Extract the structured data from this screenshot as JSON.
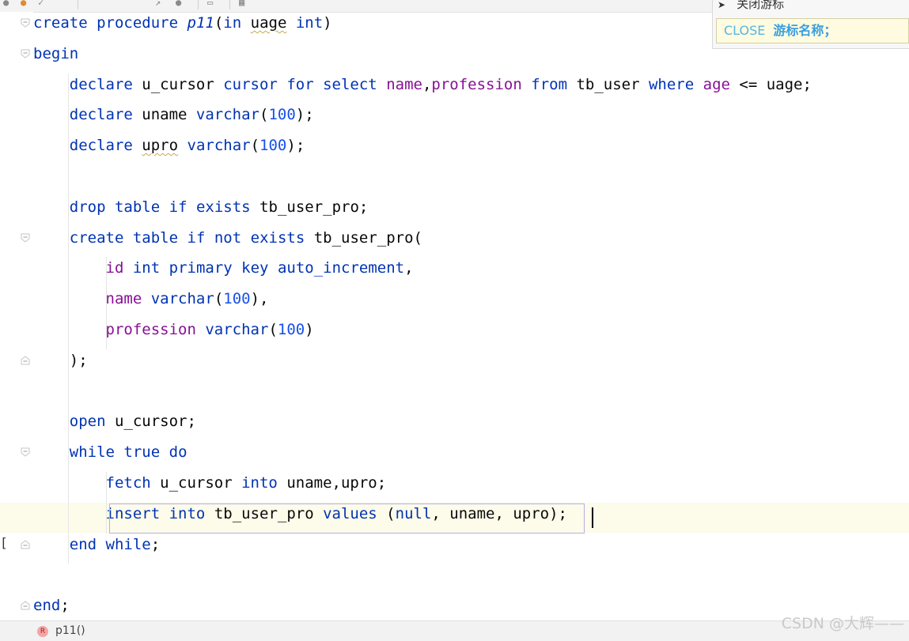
{
  "popup": {
    "item1_label": "关闭游标",
    "item2_keyword": "CLOSE",
    "item2_desc": "游标名称；"
  },
  "editor": {
    "lines": [
      {
        "tokens": [
          [
            "kw",
            "create"
          ],
          [
            "t",
            " "
          ],
          [
            "kw",
            "procedure"
          ],
          [
            "t",
            " "
          ],
          [
            "fn",
            "p11"
          ],
          [
            "t",
            "("
          ],
          [
            "kw",
            "in"
          ],
          [
            "t",
            " "
          ],
          [
            "sq",
            "uage"
          ],
          [
            "t",
            " "
          ],
          [
            "kw",
            "int"
          ],
          [
            "t",
            ")"
          ]
        ]
      },
      {
        "tokens": [
          [
            "kw",
            "begin"
          ]
        ]
      },
      {
        "tokens": [
          [
            "t",
            "    "
          ],
          [
            "kw",
            "declare"
          ],
          [
            "t",
            " u_cursor "
          ],
          [
            "kw",
            "cursor"
          ],
          [
            "t",
            " "
          ],
          [
            "kw",
            "for"
          ],
          [
            "t",
            " "
          ],
          [
            "kw",
            "select"
          ],
          [
            "t",
            " "
          ],
          [
            "col",
            "name"
          ],
          [
            "t",
            ","
          ],
          [
            "col",
            "profession"
          ],
          [
            "t",
            " "
          ],
          [
            "kw",
            "from"
          ],
          [
            "t",
            " tb_user "
          ],
          [
            "kw",
            "where"
          ],
          [
            "t",
            " "
          ],
          [
            "col",
            "age"
          ],
          [
            "t",
            " <= uage;"
          ]
        ]
      },
      {
        "tokens": [
          [
            "t",
            "    "
          ],
          [
            "kw",
            "declare"
          ],
          [
            "t",
            " uname "
          ],
          [
            "kw",
            "varchar"
          ],
          [
            "t",
            "("
          ],
          [
            "num",
            "100"
          ],
          [
            "t",
            ");"
          ]
        ]
      },
      {
        "tokens": [
          [
            "t",
            "    "
          ],
          [
            "kw",
            "declare"
          ],
          [
            "t",
            " "
          ],
          [
            "sq",
            "upro"
          ],
          [
            "t",
            " "
          ],
          [
            "kw",
            "varchar"
          ],
          [
            "t",
            "("
          ],
          [
            "num",
            "100"
          ],
          [
            "t",
            ");"
          ]
        ]
      },
      {
        "tokens": []
      },
      {
        "tokens": [
          [
            "t",
            "    "
          ],
          [
            "kw",
            "drop"
          ],
          [
            "t",
            " "
          ],
          [
            "kw",
            "table"
          ],
          [
            "t",
            " "
          ],
          [
            "kw",
            "if"
          ],
          [
            "t",
            " "
          ],
          [
            "kw",
            "exists"
          ],
          [
            "t",
            " tb_user_pro;"
          ]
        ]
      },
      {
        "tokens": [
          [
            "t",
            "    "
          ],
          [
            "kw",
            "create"
          ],
          [
            "t",
            " "
          ],
          [
            "kw",
            "table"
          ],
          [
            "t",
            " "
          ],
          [
            "kw",
            "if"
          ],
          [
            "t",
            " "
          ],
          [
            "kw",
            "not"
          ],
          [
            "t",
            " "
          ],
          [
            "kw",
            "exists"
          ],
          [
            "t",
            " tb_user_pro("
          ]
        ]
      },
      {
        "tokens": [
          [
            "t",
            "        "
          ],
          [
            "col",
            "id"
          ],
          [
            "t",
            " "
          ],
          [
            "kw",
            "int"
          ],
          [
            "t",
            " "
          ],
          [
            "kw",
            "primary"
          ],
          [
            "t",
            " "
          ],
          [
            "kw",
            "key"
          ],
          [
            "t",
            " "
          ],
          [
            "kw",
            "auto_increment"
          ],
          [
            "t",
            ","
          ]
        ]
      },
      {
        "tokens": [
          [
            "t",
            "        "
          ],
          [
            "col",
            "name"
          ],
          [
            "t",
            " "
          ],
          [
            "kw",
            "varchar"
          ],
          [
            "t",
            "("
          ],
          [
            "num",
            "100"
          ],
          [
            "t",
            "),"
          ]
        ]
      },
      {
        "tokens": [
          [
            "t",
            "        "
          ],
          [
            "col",
            "profession"
          ],
          [
            "t",
            " "
          ],
          [
            "kw",
            "varchar"
          ],
          [
            "t",
            "("
          ],
          [
            "num",
            "100"
          ],
          [
            "t",
            ")"
          ]
        ]
      },
      {
        "tokens": [
          [
            "t",
            "    );"
          ]
        ]
      },
      {
        "tokens": []
      },
      {
        "tokens": [
          [
            "t",
            "    "
          ],
          [
            "kw",
            "open"
          ],
          [
            "t",
            " u_cursor;"
          ]
        ]
      },
      {
        "tokens": [
          [
            "t",
            "    "
          ],
          [
            "kw",
            "while"
          ],
          [
            "t",
            " "
          ],
          [
            "kw",
            "true"
          ],
          [
            "t",
            " "
          ],
          [
            "kw",
            "do"
          ]
        ]
      },
      {
        "tokens": [
          [
            "t",
            "        "
          ],
          [
            "kw",
            "fetch"
          ],
          [
            "t",
            " u_cursor "
          ],
          [
            "kw",
            "into"
          ],
          [
            "t",
            " uname,upro;"
          ]
        ]
      },
      {
        "tokens": [
          [
            "t",
            "        "
          ],
          [
            "kw",
            "insert"
          ],
          [
            "t",
            " "
          ],
          [
            "kw",
            "into"
          ],
          [
            "t",
            " tb_user_pro "
          ],
          [
            "kw",
            "values"
          ],
          [
            "t",
            " ("
          ],
          [
            "kw",
            "null"
          ],
          [
            "t",
            ", uname, upro);"
          ]
        ]
      },
      {
        "tokens": [
          [
            "t",
            "    "
          ],
          [
            "kw",
            "end"
          ],
          [
            "t",
            " "
          ],
          [
            "kw",
            "while"
          ],
          [
            "t",
            ";"
          ]
        ]
      },
      {
        "tokens": []
      },
      {
        "tokens": [
          [
            "kw",
            "end"
          ],
          [
            "t",
            ";"
          ]
        ]
      }
    ]
  },
  "statusbar": {
    "badge": "R",
    "text": "p11()"
  },
  "watermark": "CSDN @大辉——"
}
